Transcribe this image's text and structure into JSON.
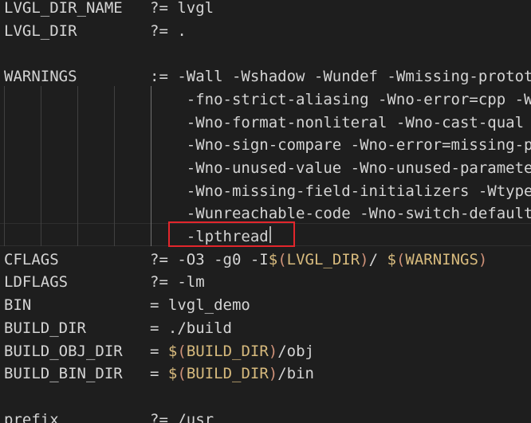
{
  "colors": {
    "background": "#1e1e1e",
    "text": "#d4d4d4",
    "dollar": "#d7ba7d",
    "paren": "#ce9178",
    "variable": "#d7ba7d",
    "highlight_border": "#e2262c"
  },
  "lines": [
    {
      "segments": [
        {
          "text": "LVGL_DIR_NAME   ?= lvgl",
          "color": "#d4d4d4"
        }
      ]
    },
    {
      "segments": [
        {
          "text": "LVGL_DIR        ?= .",
          "color": "#d4d4d4"
        }
      ]
    },
    {
      "segments": []
    },
    {
      "segments": [
        {
          "text": "WARNINGS        := -Wall -Wshadow -Wundef -Wmissing-prototypes",
          "color": "#d4d4d4"
        }
      ]
    },
    {
      "segments": [
        {
          "text": "                    -fno-strict-aliasing -Wno-error=cpp -Wuninitialized",
          "color": "#d4d4d4"
        }
      ]
    },
    {
      "segments": [
        {
          "text": "                    -Wno-format-nonliteral -Wno-cast-qual -Wunused",
          "color": "#d4d4d4"
        }
      ]
    },
    {
      "segments": [
        {
          "text": "                    -Wno-sign-compare -Wno-error=missing-prototypes",
          "color": "#d4d4d4"
        }
      ]
    },
    {
      "segments": [
        {
          "text": "                    -Wno-unused-value -Wno-unused-parameter",
          "color": "#d4d4d4"
        }
      ]
    },
    {
      "segments": [
        {
          "text": "                    -Wno-missing-field-initializers -Wtype-limits",
          "color": "#d4d4d4"
        }
      ]
    },
    {
      "segments": [
        {
          "text": "                    -Wunreachable-code -Wno-switch-default",
          "color": "#d4d4d4"
        }
      ]
    },
    {
      "segments": [
        {
          "text": "                    -lpthread",
          "color": "#d4d4d4"
        }
      ]
    },
    {
      "segments": [
        {
          "text": "CFLAGS          ?= -O3 -g0 -I",
          "color": "#d4d4d4"
        },
        {
          "text": "$",
          "color": "#d7ba7d"
        },
        {
          "text": "(",
          "color": "#ce9178"
        },
        {
          "text": "LVGL_DIR",
          "color": "#d7ba7d"
        },
        {
          "text": ")",
          "color": "#ce9178"
        },
        {
          "text": "/ ",
          "color": "#d4d4d4"
        },
        {
          "text": "$",
          "color": "#d7ba7d"
        },
        {
          "text": "(",
          "color": "#ce9178"
        },
        {
          "text": "WARNINGS",
          "color": "#d7ba7d"
        },
        {
          "text": ")",
          "color": "#ce9178"
        }
      ]
    },
    {
      "segments": [
        {
          "text": "LDFLAGS         ?= -lm",
          "color": "#d4d4d4"
        }
      ]
    },
    {
      "segments": [
        {
          "text": "BIN             = lvgl_demo",
          "color": "#d4d4d4"
        }
      ]
    },
    {
      "segments": [
        {
          "text": "BUILD_DIR       = ./build",
          "color": "#d4d4d4"
        }
      ]
    },
    {
      "segments": [
        {
          "text": "BUILD_OBJ_DIR   = ",
          "color": "#d4d4d4"
        },
        {
          "text": "$",
          "color": "#d7ba7d"
        },
        {
          "text": "(",
          "color": "#ce9178"
        },
        {
          "text": "BUILD_DIR",
          "color": "#d7ba7d"
        },
        {
          "text": ")",
          "color": "#ce9178"
        },
        {
          "text": "/obj",
          "color": "#d4d4d4"
        }
      ]
    },
    {
      "segments": [
        {
          "text": "BUILD_BIN_DIR   = ",
          "color": "#d4d4d4"
        },
        {
          "text": "$",
          "color": "#d7ba7d"
        },
        {
          "text": "(",
          "color": "#ce9178"
        },
        {
          "text": "BUILD_DIR",
          "color": "#d7ba7d"
        },
        {
          "text": ")",
          "color": "#ce9178"
        },
        {
          "text": "/bin",
          "color": "#d4d4d4"
        }
      ]
    },
    {
      "segments": []
    },
    {
      "segments": [
        {
          "text": "prefix          ?= /usr",
          "color": "#d4d4d4"
        }
      ]
    }
  ]
}
